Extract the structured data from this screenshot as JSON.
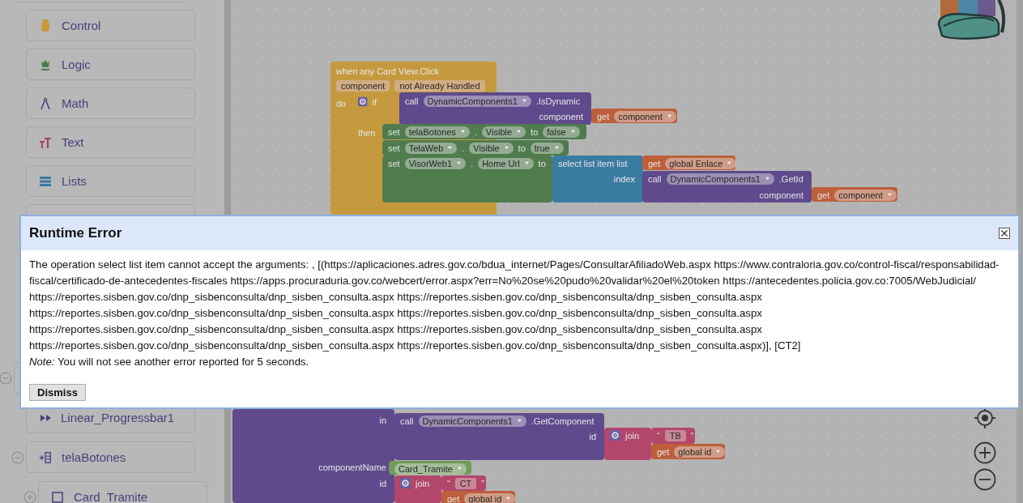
{
  "sidebar": {
    "categories": [
      {
        "label": "Control"
      },
      {
        "label": "Logic"
      },
      {
        "label": "Math"
      },
      {
        "label": "Text"
      },
      {
        "label": "Lists"
      }
    ],
    "components": [
      {
        "expanded": true,
        "children": [
          {
            "label": "Linear_Progressbar1"
          },
          {
            "label": "telaBotones",
            "expanded": true,
            "children": [
              {
                "label": "Card_Tramite",
                "expanded": false
              }
            ]
          }
        ]
      }
    ]
  },
  "blocks": [
    {
      "kind": "event",
      "lines": [
        [
          {
            "kind": "word",
            "text": "when any Card View.Click"
          }
        ],
        [
          {
            "kind": "param",
            "text": "component"
          },
          {
            "kind": "param",
            "text": "not Already Handled"
          }
        ],
        [
          {
            "kind": "word",
            "text": "do"
          }
        ]
      ]
    },
    {
      "kind": "control",
      "lines": [
        [
          {
            "kind": "gear"
          },
          {
            "kind": "word",
            "text": "if"
          }
        ],
        [
          {
            "kind": "word",
            "text": "then"
          }
        ]
      ]
    },
    {
      "kind": "procedure",
      "lines": [
        [
          {
            "kind": "word",
            "text": "call"
          },
          {
            "kind": "dropdown",
            "text": "DynamicComponents1"
          },
          {
            "kind": "word",
            "text": ".IsDynamic"
          }
        ],
        [
          {
            "kind": "input",
            "text": "component"
          }
        ]
      ]
    },
    {
      "kind": "getter",
      "lines": [
        [
          {
            "kind": "word",
            "text": "get"
          },
          {
            "kind": "dropdown",
            "text": "component"
          }
        ]
      ]
    },
    {
      "kind": "setter",
      "lines": [
        [
          {
            "kind": "word",
            "text": "set"
          },
          {
            "kind": "dropdown",
            "text": "telaBotones"
          },
          {
            "kind": "word",
            "text": "."
          },
          {
            "kind": "dropdown",
            "text": "Visible"
          },
          {
            "kind": "word",
            "text": "to"
          },
          {
            "kind": "dropdown",
            "text": "false"
          }
        ]
      ]
    },
    {
      "kind": "setter",
      "lines": [
        [
          {
            "kind": "word",
            "text": "set"
          },
          {
            "kind": "dropdown",
            "text": "TelaWeb"
          },
          {
            "kind": "word",
            "text": "."
          },
          {
            "kind": "dropdown",
            "text": "Visible"
          },
          {
            "kind": "word",
            "text": "to"
          },
          {
            "kind": "dropdown",
            "text": "true"
          }
        ]
      ]
    },
    {
      "kind": "setter",
      "lines": [
        [
          {
            "kind": "word",
            "text": "set"
          },
          {
            "kind": "dropdown",
            "text": "VisorWeb1"
          },
          {
            "kind": "word",
            "text": "."
          },
          {
            "kind": "dropdown",
            "text": "Home Url"
          },
          {
            "kind": "word",
            "text": "to"
          }
        ]
      ]
    },
    {
      "kind": "lists",
      "lines": [
        [
          {
            "kind": "word",
            "text": "select list item  list"
          }
        ],
        [
          {
            "kind": "input",
            "text": "index"
          }
        ]
      ]
    },
    {
      "kind": "getter",
      "lines": [
        [
          {
            "kind": "word",
            "text": "get"
          },
          {
            "kind": "dropdown",
            "text": "global Enlace"
          }
        ]
      ]
    },
    {
      "kind": "procedure",
      "lines": [
        [
          {
            "kind": "word",
            "text": "call"
          },
          {
            "kind": "dropdown",
            "text": "DynamicComponents1"
          },
          {
            "kind": "word",
            "text": ".GetId"
          }
        ],
        [
          {
            "kind": "input",
            "text": "component"
          }
        ]
      ]
    },
    {
      "kind": "getter",
      "lines": [
        [
          {
            "kind": "word",
            "text": "get"
          },
          {
            "kind": "dropdown",
            "text": "component"
          }
        ]
      ]
    },
    {
      "kind": "procedure",
      "lines": [
        [
          {
            "kind": "input",
            "text": "in"
          }
        ],
        [
          {
            "kind": "input",
            "text": "componentName"
          }
        ],
        [
          {
            "kind": "input",
            "text": "id"
          }
        ]
      ]
    },
    {
      "kind": "procedure",
      "lines": [
        [
          {
            "kind": "word",
            "text": "call"
          },
          {
            "kind": "dropdown",
            "text": "DynamicComponents1"
          },
          {
            "kind": "word",
            "text": ".GetComponent"
          }
        ],
        [
          {
            "kind": "input",
            "text": "id"
          }
        ]
      ]
    },
    {
      "kind": "join",
      "lines": [
        [
          {
            "kind": "gear"
          },
          {
            "kind": "word",
            "text": "join"
          }
        ]
      ]
    },
    {
      "kind": "text",
      "lines": [
        [
          {
            "kind": "word",
            "text": "“"
          },
          {
            "kind": "param",
            "text": "TB"
          },
          {
            "kind": "word",
            "text": "”"
          }
        ]
      ]
    },
    {
      "kind": "getter",
      "lines": [
        [
          {
            "kind": "word",
            "text": "get"
          },
          {
            "kind": "dropdown",
            "text": "global id"
          }
        ]
      ]
    },
    {
      "kind": "component",
      "lines": [
        [
          {
            "kind": "dropdown",
            "text": "Card_Tramite"
          }
        ]
      ]
    },
    {
      "kind": "join",
      "lines": [
        [
          {
            "kind": "gear"
          },
          {
            "kind": "word",
            "text": "join"
          }
        ]
      ]
    },
    {
      "kind": "text",
      "lines": [
        [
          {
            "kind": "word",
            "text": "“"
          },
          {
            "kind": "param",
            "text": "CT"
          },
          {
            "kind": "word",
            "text": "”"
          }
        ]
      ]
    },
    {
      "kind": "getter",
      "lines": [
        [
          {
            "kind": "word",
            "text": "get"
          },
          {
            "kind": "dropdown",
            "text": "global id"
          }
        ]
      ]
    }
  ],
  "dialog": {
    "title": "Runtime Error",
    "message": "The operation select list item cannot accept the arguments: , [(https://aplicaciones.adres.gov.co/bdua_internet/Pages/ConsultarAfiliadoWeb.aspx https://www.contraloria.gov.co/control-fiscal/responsabilidad-fiscal/certificado-de-antecedentes-fiscales https://apps.procuraduria.gov.co/webcert/error.aspx?err=No%20se%20pudo%20validar%20el%20token https://antecedentes.policia.gov.co:7005/WebJudicial/ https://reportes.sisben.gov.co/dnp_sisbenconsulta/dnp_sisben_consulta.aspx https://reportes.sisben.gov.co/dnp_sisbenconsulta/dnp_sisben_consulta.aspx https://reportes.sisben.gov.co/dnp_sisbenconsulta/dnp_sisben_consulta.aspx https://reportes.sisben.gov.co/dnp_sisbenconsulta/dnp_sisben_consulta.aspx https://reportes.sisben.gov.co/dnp_sisbenconsulta/dnp_sisben_consulta.aspx https://reportes.sisben.gov.co/dnp_sisbenconsulta/dnp_sisben_consulta.aspx https://reportes.sisben.gov.co/dnp_sisbenconsulta/dnp_sisben_consulta.aspx https://reportes.sisben.gov.co/dnp_sisbenconsulta/dnp_sisben_consulta.aspx)], [CT2]",
    "note": "*Note:* You will not see another error reported for 5 seconds.",
    "button": "Dismiss"
  }
}
